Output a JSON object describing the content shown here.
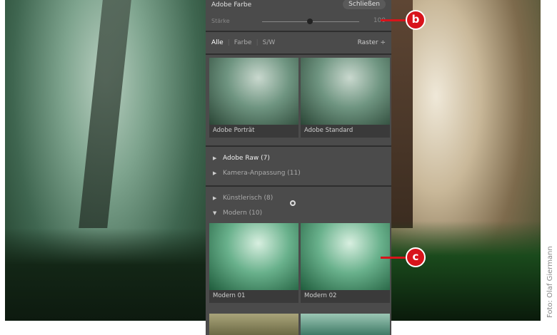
{
  "panel": {
    "title": "Adobe Farbe",
    "close_label": "Schließen",
    "strength_label": "Stärke",
    "strength_value": "100",
    "tabs": [
      "Alle",
      "Farbe",
      "S/W"
    ],
    "view_label": "Raster ÷",
    "favorites": [
      "Adobe Porträt",
      "Adobe Standard"
    ],
    "groups": [
      {
        "label": "Adobe Raw (7)",
        "expanded": false
      },
      {
        "label": "Kamera-Anpassung (11)",
        "expanded": false
      },
      {
        "label": "Künstlerisch (8)",
        "expanded": false
      },
      {
        "label": "Modern (10)",
        "expanded": true
      }
    ],
    "modern_profiles": [
      "Modern 01",
      "Modern 02"
    ]
  },
  "callouts": {
    "b": "b",
    "c": "c"
  },
  "credit": "Foto: Olaf Giermann",
  "colors": {
    "callout": "#d8141b",
    "panel": "#4b4b4b"
  }
}
